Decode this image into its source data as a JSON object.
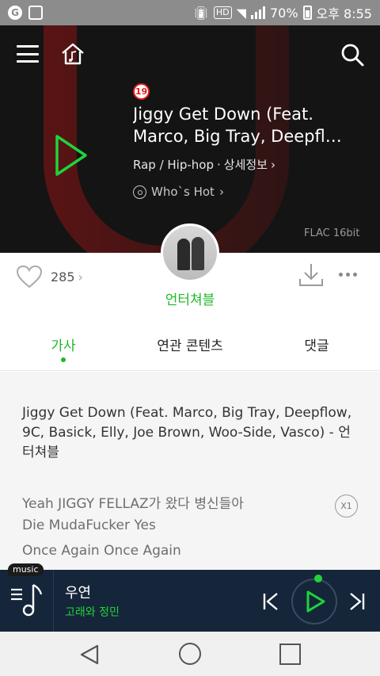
{
  "status_bar": {
    "battery": "70%",
    "time": "오후 8:55",
    "hd_label": "HD"
  },
  "hero": {
    "age_rating": "19",
    "title_line1": "Jiggy Get Down (Feat.",
    "title_line2": "Marco, Big Tray, Deepfl…",
    "genre": "Rap / Hip-hop",
    "separator": "·",
    "details": "상세정보",
    "who_hot": "Who`s Hot",
    "quality": "FLAC 16bit"
  },
  "actions": {
    "like_count": "285",
    "artist_name": "언터쳐블"
  },
  "tabs": [
    {
      "label": "가사",
      "active": true
    },
    {
      "label": "연관 콘텐츠",
      "active": false
    },
    {
      "label": "댓글",
      "active": false
    }
  ],
  "lyrics": {
    "header": "Jiggy Get Down (Feat. Marco, Big Tray, Deepflow, 9C, Basick, Elly, Joe Brown, Woo-Side, Vasco) - 언터쳐블",
    "lines": [
      "Yeah JIGGY FELLAZ가 왔다 병신들아",
      "Die MudaFucker Yes",
      "Once Again Once Again"
    ],
    "speed": "X1"
  },
  "mini_player": {
    "tag": "music",
    "title": "우연",
    "artist": "고래와 정민"
  },
  "colors": {
    "accent": "#1fb82a",
    "player_bg": "#16263a",
    "hero_bg": "#141414"
  }
}
